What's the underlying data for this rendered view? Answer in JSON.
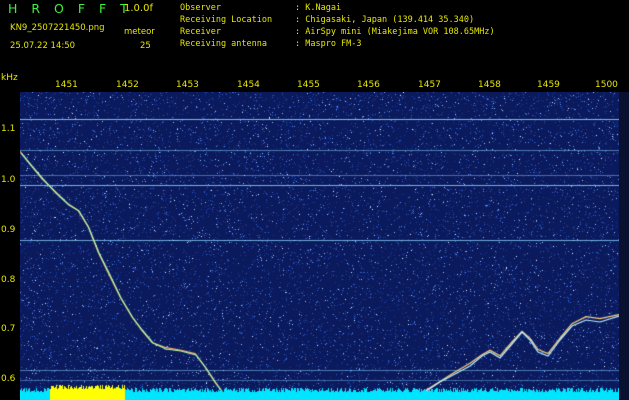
{
  "header": {
    "brand": "H R O F F T",
    "version": "1.0.0f",
    "filename": "KN9_2507221450.png",
    "meteor_label": "meteor",
    "datetime": "25.07.22 14:50",
    "meteor_count": "25"
  },
  "info": [
    {
      "key": "Observer",
      "value": ": K.Nagai"
    },
    {
      "key": "Receiving Location",
      "value": ": Chigasaki, Japan (139.414 35.340)"
    },
    {
      "key": "Receiver",
      "value": ": AirSpy mini (Miakejima VOR 108.65MHz)"
    },
    {
      "key": "Receiving antenna",
      "value": ": Maspro FM-3"
    }
  ],
  "axis": {
    "y_unit": "kHz",
    "y_ticks": [
      "1.1",
      "1.0",
      "0.9",
      "0.8",
      "0.7",
      "0.6"
    ],
    "x_ticks": [
      "1451",
      "1452",
      "1453",
      "1454",
      "1455",
      "1456",
      "1457",
      "1458",
      "1459",
      "1500"
    ]
  },
  "colors": {
    "text": "#e6e600",
    "brand": "#3cf23c",
    "background": "#0b1a5c",
    "echo_bar": "#ffff00",
    "noise_bar": "#00e5ff",
    "carrier": "#8fd8ff"
  }
}
